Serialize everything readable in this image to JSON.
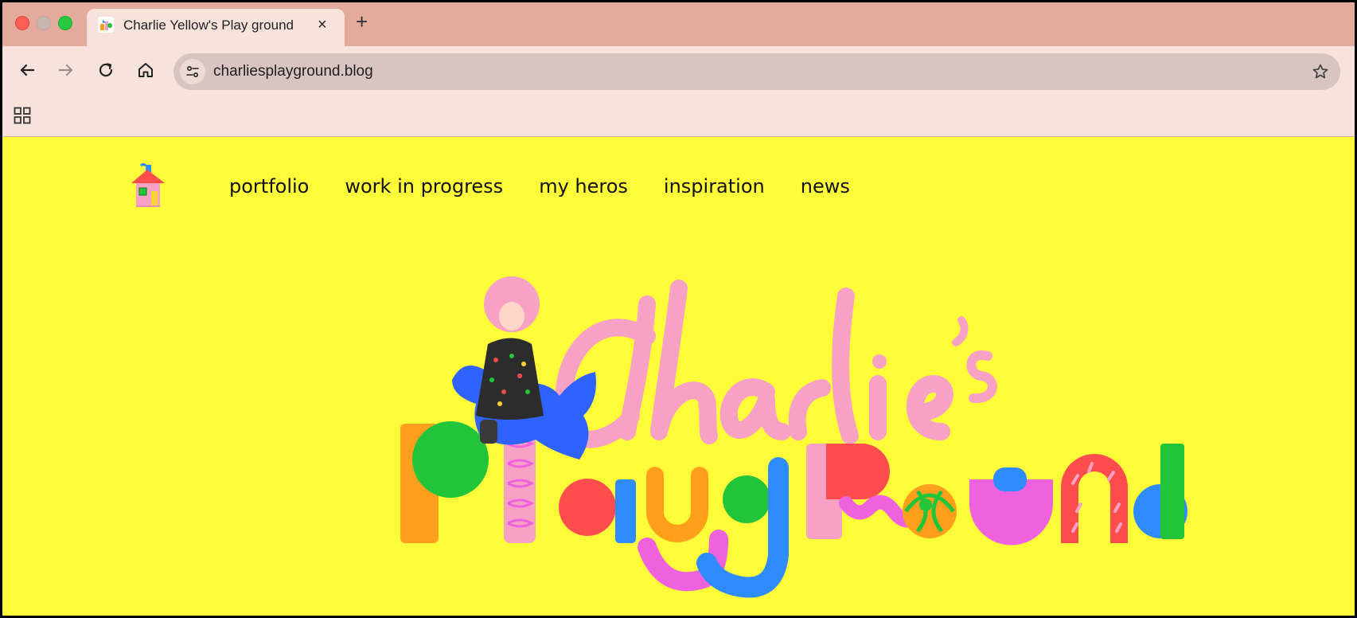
{
  "browser": {
    "tab_title": "Charlie Yellow's Play ground",
    "tab_close_glyph": "×",
    "new_tab_glyph": "+",
    "url": "charliesplayground.blog",
    "icons": [
      "close-window",
      "minimize-window",
      "maximize-window",
      "back-arrow",
      "forward-arrow",
      "reload",
      "home",
      "site-info",
      "bookmark-star",
      "apps-grid"
    ]
  },
  "site": {
    "nav": [
      "portfolio",
      "work in progress",
      "my heros",
      "inspiration",
      "news"
    ]
  },
  "colors": {
    "page_background": "#fffd3a",
    "tab_strip": "#e4ab9c",
    "toolbar": "#f8e2dc",
    "omnibox": "#d8c4c0",
    "hero_pink": "#f7a1c4",
    "hero_orange": "#ff9f1c",
    "hero_green": "#22c53a",
    "hero_red": "#ff4d4d",
    "hero_blue": "#2f8cff",
    "hero_magenta": "#ee62de"
  }
}
